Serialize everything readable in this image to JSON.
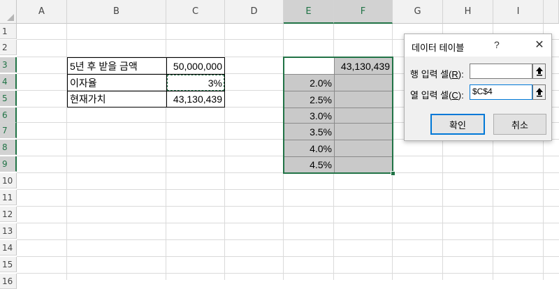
{
  "columns": [
    "A",
    "B",
    "C",
    "D",
    "E",
    "F",
    "G",
    "H",
    "I"
  ],
  "rows": [
    "1",
    "2",
    "3",
    "4",
    "5",
    "6",
    "7",
    "8",
    "9",
    "10",
    "11",
    "12",
    "13",
    "14",
    "15",
    "16"
  ],
  "cells": {
    "b3": "5년 후 받을 금액",
    "c3": "50,000,000",
    "b4": "이자율",
    "c4": "3%",
    "b5": "현재가치",
    "c5": "43,130,439",
    "f3": "43,130,439",
    "e_rates": [
      "2.0%",
      "2.5%",
      "3.0%",
      "3.5%",
      "4.0%",
      "4.5%"
    ]
  },
  "dialog": {
    "title": "데이터 테이블",
    "help": "?",
    "close": "✕",
    "row_label": "행 입력 셀(",
    "row_key": "R",
    "row_label_end": "):",
    "row_value": "",
    "col_label": "열 입력 셀(",
    "col_key": "C",
    "col_label_end": "):",
    "col_value": "$C$4",
    "ok_label": "확인",
    "cancel_label": "취소"
  }
}
